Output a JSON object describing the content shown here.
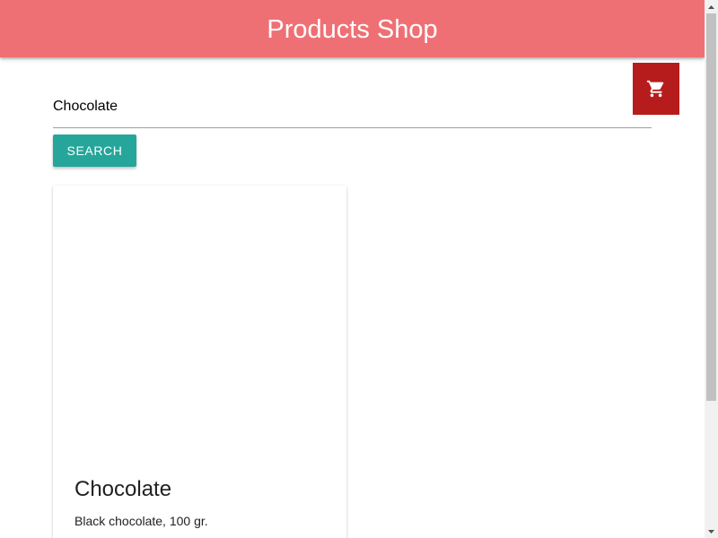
{
  "header": {
    "title": "Products Shop"
  },
  "cart": {
    "icon": "shopping-cart-icon"
  },
  "search": {
    "value": "Chocolate",
    "placeholder": "",
    "button_label": "Search"
  },
  "products": [
    {
      "name": "Chocolate",
      "description": "Black chocolate, 100 gr."
    }
  ],
  "colors": {
    "header_bg": "#ef7074",
    "cart_bg": "#b71c1c",
    "button_bg": "#26a69a"
  }
}
